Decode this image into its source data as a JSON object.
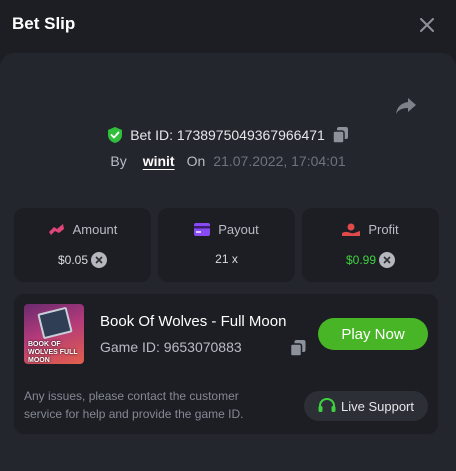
{
  "header": {
    "title": "Bet Slip"
  },
  "bet": {
    "id_label": "Bet ID:",
    "id_value": "1738975049367966471",
    "by_label": "By",
    "username": "winit",
    "on_label": "On",
    "date": "21.07.2022, 17:04:01"
  },
  "stats": [
    {
      "label": "Amount",
      "value": "$0.05",
      "icon": "amount-icon",
      "color": "#e0457a"
    },
    {
      "label": "Payout",
      "value": "21 x",
      "icon": "payout-icon",
      "color": "#8a4af3"
    },
    {
      "label": "Profit",
      "value": "$0.99",
      "icon": "profit-icon",
      "color": "#e04a4a"
    }
  ],
  "game": {
    "thumb_text": "BOOK OF WOLVES FULL MOON",
    "name": "Book Of Wolves - Full Moon",
    "id_label": "Game ID:",
    "id_value": "9653070883",
    "play_label": "Play Now"
  },
  "support": {
    "text": "Any issues, please contact the customer service for help and provide the game ID.",
    "button_label": "Live Support"
  },
  "colors": {
    "background": "#1c1e24",
    "panel": "#24262d",
    "accent_green": "#48b526",
    "profit_green": "#3fd13f",
    "shield_green": "#2fbf3a"
  }
}
